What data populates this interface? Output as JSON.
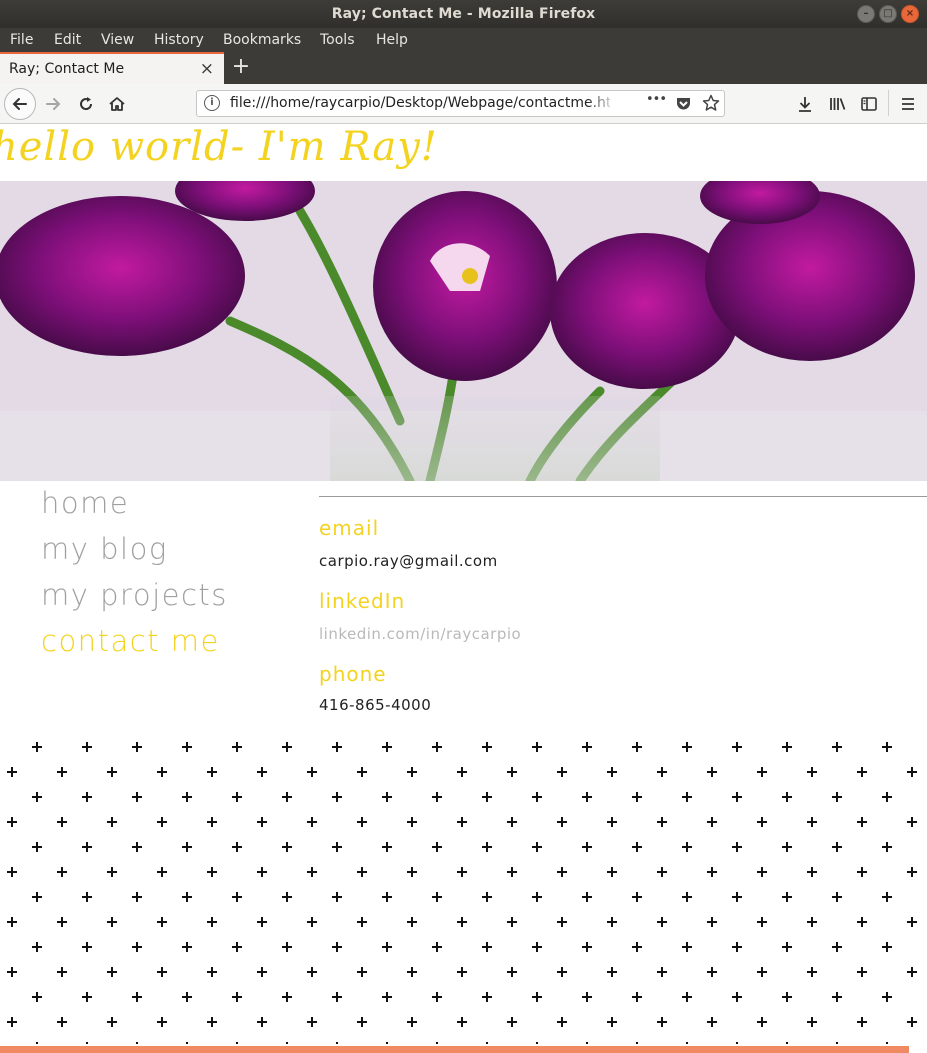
{
  "window": {
    "title": "Ray; Contact Me - Mozilla Firefox",
    "controls": [
      "–",
      "□",
      "×"
    ]
  },
  "menu": {
    "items": [
      {
        "label": "File"
      },
      {
        "label": "Edit"
      },
      {
        "label": "View"
      },
      {
        "label": "History"
      },
      {
        "label": "Bookmarks"
      },
      {
        "label": "Tools"
      },
      {
        "label": "Help"
      }
    ]
  },
  "tab": {
    "label": "Ray; Contact Me",
    "close": "×",
    "new_tab": "+"
  },
  "navbar": {
    "url": "file:///home/raycarpio/Desktop/Webpage/contactme.html",
    "page_actions": "•••"
  },
  "page": {
    "banner_text": "hello world- I'm Ray!",
    "nav": [
      {
        "label": "home",
        "active": false
      },
      {
        "label": "my blog",
        "active": false
      },
      {
        "label": "my projects",
        "active": false
      },
      {
        "label": "contact me",
        "active": true
      }
    ],
    "contact": {
      "email_heading": "email",
      "email_value": "carpio.ray@gmail.com",
      "linkedin_heading": "linkedIn",
      "linkedin_value": "linkedin.com/in/raycarpio",
      "phone_heading": "phone",
      "phone_value": "416-865-4000"
    }
  },
  "colors": {
    "accent_yellow": "#f3d31f",
    "nav_gray": "#9f9f9f",
    "tab_accent": "#e9683b",
    "titlebar": "#3c3b37"
  }
}
